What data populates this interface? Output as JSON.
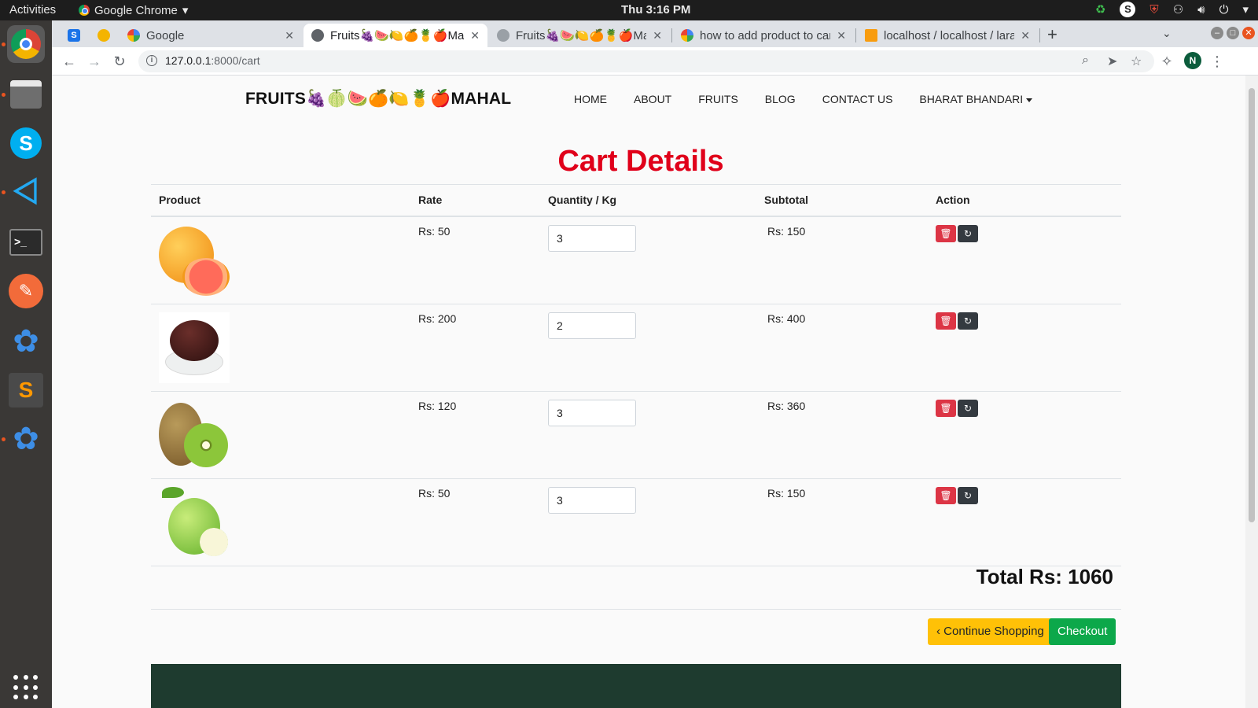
{
  "topbar": {
    "activities": "Activities",
    "app_name": "Google Chrome",
    "clock": "Thu  3:16 PM"
  },
  "dock": {
    "items": [
      "chrome",
      "files",
      "skype",
      "vscode",
      "terminal",
      "postman",
      "app-dark",
      "sublime",
      "app-light"
    ]
  },
  "browser": {
    "tabs": [
      {
        "label": "",
        "icon": "s-icon"
      },
      {
        "label": "",
        "icon": "emoji-icon"
      },
      {
        "label": "Google"
      },
      {
        "label": "Fruits🍇🍉🍋🍊🍍🍎Mahal",
        "active": true
      },
      {
        "label": "Fruits🍇🍉🍋🍊🍍🍎Mahal"
      },
      {
        "label": "how to add product to cart"
      },
      {
        "label": "localhost / localhost / lara"
      }
    ],
    "url_host": "127.0.0.1",
    "url_path": ":8000/cart",
    "profile_initial": "N"
  },
  "site": {
    "brand": "FRUITS🍇🍈🍉🍊🍋🍍🍎MAHAL",
    "nav": [
      "HOME",
      "ABOUT",
      "FRUITS",
      "BLOG",
      "CONTACT US"
    ],
    "user_menu": "BHARAT BHANDARI",
    "page_title": "Cart Details",
    "table": {
      "headers": [
        "Product",
        "Rate",
        "Quantity / Kg",
        "Subtotal",
        "Action"
      ],
      "rows": [
        {
          "rate": "Rs: 50",
          "qty": "3",
          "subtotal": "Rs: 150",
          "image": "grapefruit"
        },
        {
          "rate": "Rs: 200",
          "qty": "2",
          "subtotal": "Rs: 400",
          "image": "dates"
        },
        {
          "rate": "Rs: 120",
          "qty": "3",
          "subtotal": "Rs: 360",
          "image": "kiwi"
        },
        {
          "rate": "Rs: 50",
          "qty": "3",
          "subtotal": "Rs: 150",
          "image": "green-apple"
        }
      ]
    },
    "total": "Total Rs: 1060",
    "continue_label": "Continue Shopping",
    "checkout_label": "Checkout"
  },
  "colors": {
    "title_red": "#e0001a",
    "delete_red": "#dc3545",
    "update_dark": "#343a40",
    "continue_yellow": "#ffc107",
    "checkout_green": "#0ca84a",
    "footer_green": "#1e3b2f"
  }
}
